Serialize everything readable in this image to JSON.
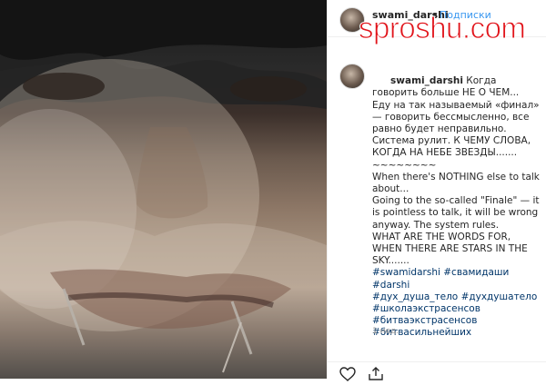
{
  "post": {
    "username": "swami_darshi",
    "follow_label": "Подписки",
    "dot": "•",
    "watermark": "sproshu.com",
    "caption": {
      "username": "swami_darshi",
      "text_ru": " Когда говорить больше НЕ О ЧЕМ...\nЕду на так называемый «финал» — говорить бессмысленно, все равно будет неправильно. Система рулит. К ЧЕМУ СЛОВА, КОГДА НА НЕБЕ ЗВЕЗДЫ.......\n~~~~~~~~\nWhen there's NOTHING else to talk about...\nGoing to the so-called \"Finale\" — it is pointless to talk, it will be wrong anyway. The system rules.\nWHAT ARE THE WORDS FOR, WHEN THERE ARE STARS IN THE SKY.......\n",
      "hashtags": [
        "#swamidarshi",
        " ",
        "#свамидаши",
        " ",
        "#darshi",
        "\n",
        "#дух_душа_тело",
        " ",
        "#духдушатело",
        "\n",
        "#школаэкстрасенсов",
        "\n",
        "#битваэкстрасенсов",
        "\n",
        "#битвасильнейших"
      ]
    },
    "time": "1 нед.",
    "icons": {
      "like": "heart-icon",
      "share": "share-icon"
    },
    "colors": {
      "link": "#3897f0",
      "hashtag": "#003569",
      "watermark": "#e1141b",
      "muted": "#999999"
    }
  }
}
